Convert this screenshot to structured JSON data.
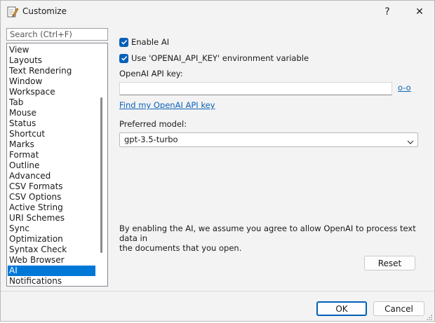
{
  "window": {
    "title": "Customize",
    "help_label": "?",
    "close_label": "✕"
  },
  "sidebar": {
    "search_placeholder": "Search (Ctrl+F)",
    "items": [
      {
        "label": "View"
      },
      {
        "label": "Layouts"
      },
      {
        "label": "Text Rendering"
      },
      {
        "label": "Window"
      },
      {
        "label": "Workspace"
      },
      {
        "label": "Tab"
      },
      {
        "label": "Mouse"
      },
      {
        "label": "Status"
      },
      {
        "label": "Shortcut"
      },
      {
        "label": "Marks"
      },
      {
        "label": "Format"
      },
      {
        "label": "Outline"
      },
      {
        "label": "Advanced"
      },
      {
        "label": "CSV Formats"
      },
      {
        "label": "CSV Options"
      },
      {
        "label": "Active String"
      },
      {
        "label": "URI Schemes"
      },
      {
        "label": "Sync"
      },
      {
        "label": "Optimization"
      },
      {
        "label": "Syntax Check"
      },
      {
        "label": "Web Browser"
      },
      {
        "label": "AI",
        "selected": true
      },
      {
        "label": "Notifications"
      }
    ]
  },
  "ai_settings": {
    "enable_ai": {
      "label": "Enable AI",
      "checked": true
    },
    "use_env_var": {
      "label": "Use 'OPENAI_API_KEY' environment variable",
      "checked": true
    },
    "api_key_label": "OpenAI API key:",
    "api_key_value": "",
    "reveal_label": "o-o",
    "find_key_link": "Find my OpenAI API key",
    "model_label": "Preferred model:",
    "model_value": "gpt-3.5-turbo",
    "notice_line1": "By enabling the AI, we assume you agree to allow OpenAI to process text data in",
    "notice_line2": "the documents that you open.",
    "reset_label": "Reset"
  },
  "footer": {
    "ok_label": "OK",
    "cancel_label": "Cancel"
  },
  "colors": {
    "accent": "#005fb8",
    "selection": "#0078d7",
    "link": "#0b63b6"
  }
}
